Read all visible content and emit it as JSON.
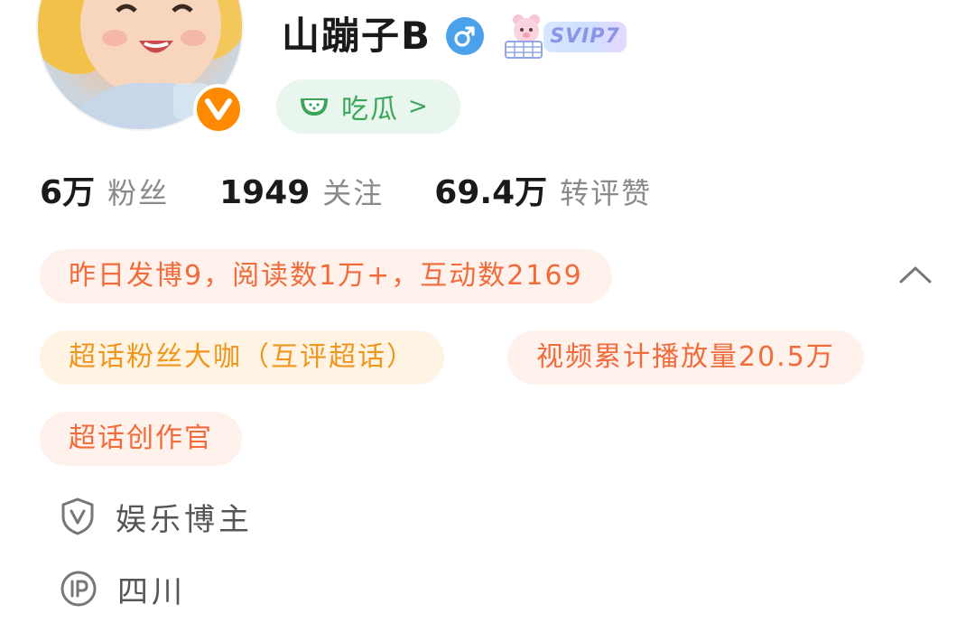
{
  "profile": {
    "username": "山蹦子B",
    "svip_label": "SVIP7",
    "chigua_label": "吃瓜",
    "chigua_arrow": ">"
  },
  "stats": [
    {
      "value": "6万",
      "label": "粉丝"
    },
    {
      "value": "1949",
      "label": "关注"
    },
    {
      "value": "69.4万",
      "label": "转评赞"
    }
  ],
  "chips": {
    "daily": "昨日发博9，阅读数1万+，互动数2169",
    "supertopic_fan": "超话粉丝大咖（互评超话）",
    "video_views": "视频累计播放量20.5万",
    "creator": "超话创作官"
  },
  "info": {
    "category": "娱乐博主",
    "ip_location": "四川"
  },
  "icons": {
    "verified": "verified-v-icon",
    "gender": "male-icon",
    "watermelon": "watermelon-icon",
    "collapse": "chevron-up-icon",
    "shield": "shield-v-icon",
    "ip": "ip-icon"
  },
  "colors": {
    "orange": "#f26b3a",
    "yellow": "#f0961e",
    "green": "#3aa65a",
    "blue": "#4aa3ea",
    "verified": "#ff8a00"
  }
}
